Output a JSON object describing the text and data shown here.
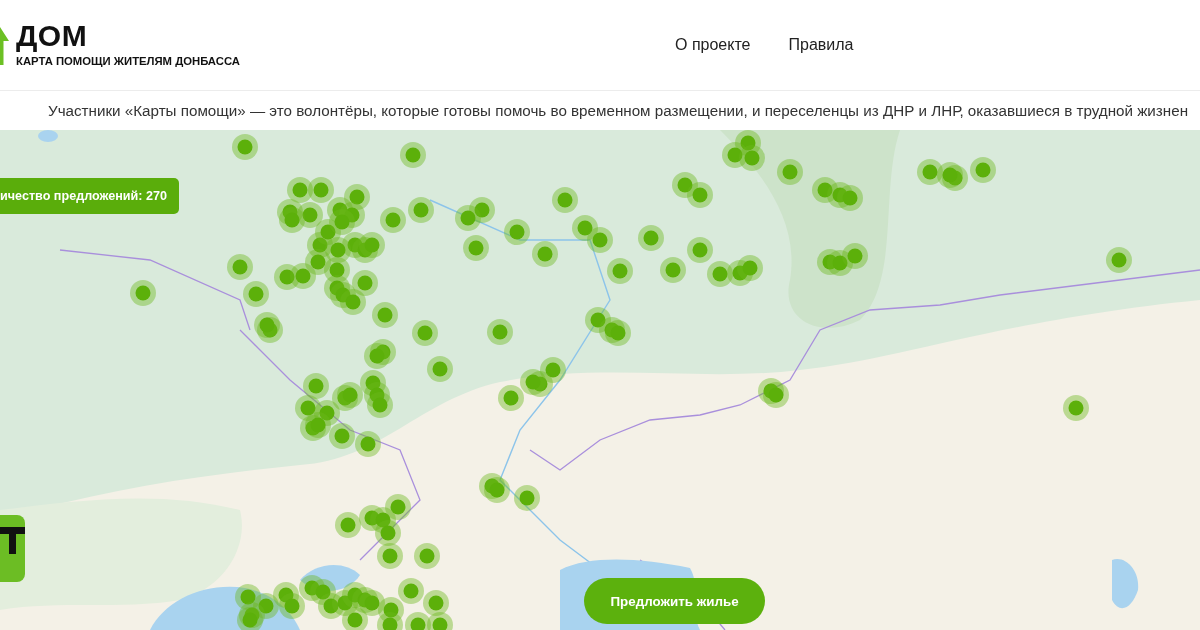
{
  "header": {
    "logo": {
      "title": "ДОМ",
      "subtitle": "КАРТА ПОМОЩИ ЖИТЕЛЯМ ДОНБАССА"
    },
    "nav": [
      "О проекте",
      "Правила"
    ]
  },
  "intro": "Участники «Карты помощи» — это волонтёры, которые готовы помочь во временном размещении, и переселенцы из ДНР и ЛНР, оказавшиеся в трудной жизнен",
  "map": {
    "offers_count": "ичество предложений: 270",
    "offer_button": "Предложить жилье"
  }
}
